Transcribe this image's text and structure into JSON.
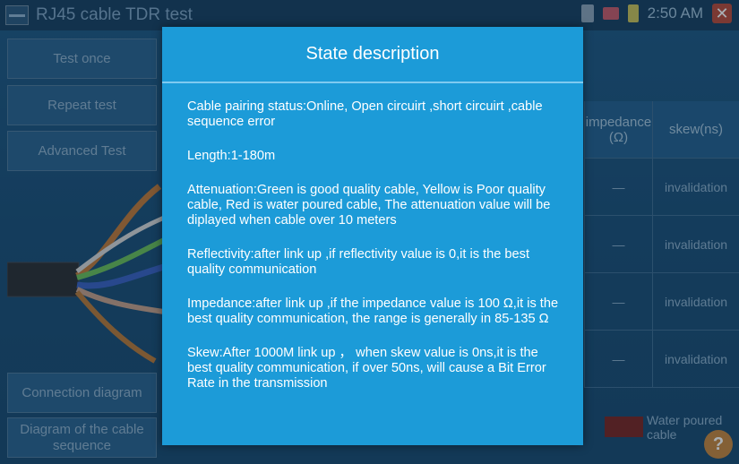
{
  "app": {
    "title": "RJ45 cable TDR test",
    "clock": "2:50 AM",
    "close_icon": "close-icon"
  },
  "sidebar": {
    "test_once": "Test once",
    "repeat_test": "Repeat test",
    "advanced_test": "Advanced Test",
    "connection_diagram": "Connection diagram",
    "cable_sequence": "Diagram of the cable sequence"
  },
  "table": {
    "headers": [
      "impedance (Ω)",
      "skew(ns)"
    ],
    "rows": [
      [
        "—",
        "invalidation"
      ],
      [
        "—",
        "invalidation"
      ],
      [
        "—",
        "invalidation"
      ],
      [
        "—",
        "invalidation"
      ]
    ]
  },
  "legend": {
    "label": "Water poured cable",
    "color": "#7a2622"
  },
  "dialog": {
    "title": "State description",
    "paragraphs": [
      "Cable pairing status:Online, Open circuirt ,short circuirt ,cable sequence error",
      "Length:1-180m",
      "Attenuation:Green is good quality cable, Yellow is Poor quality cable, Red is water poured cable, The attenuation value will be diplayed when cable over 10 meters",
      "Reflectivity:after link up ,if reflectivity value is 0,it is the best quality communication",
      "Impedance:after link up ,if the impedance value is 100 Ω,it is the best quality communication, the range is generally in 85-135 Ω",
      "Skew:After 1000M link up ， when skew value is 0ns,it is the best quality communication, if over 50ns, will cause a Bit Error Rate in the transmission"
    ]
  },
  "colors": {
    "dialog_bg": "#1c9bd8",
    "app_bg": "#1b4f78"
  }
}
